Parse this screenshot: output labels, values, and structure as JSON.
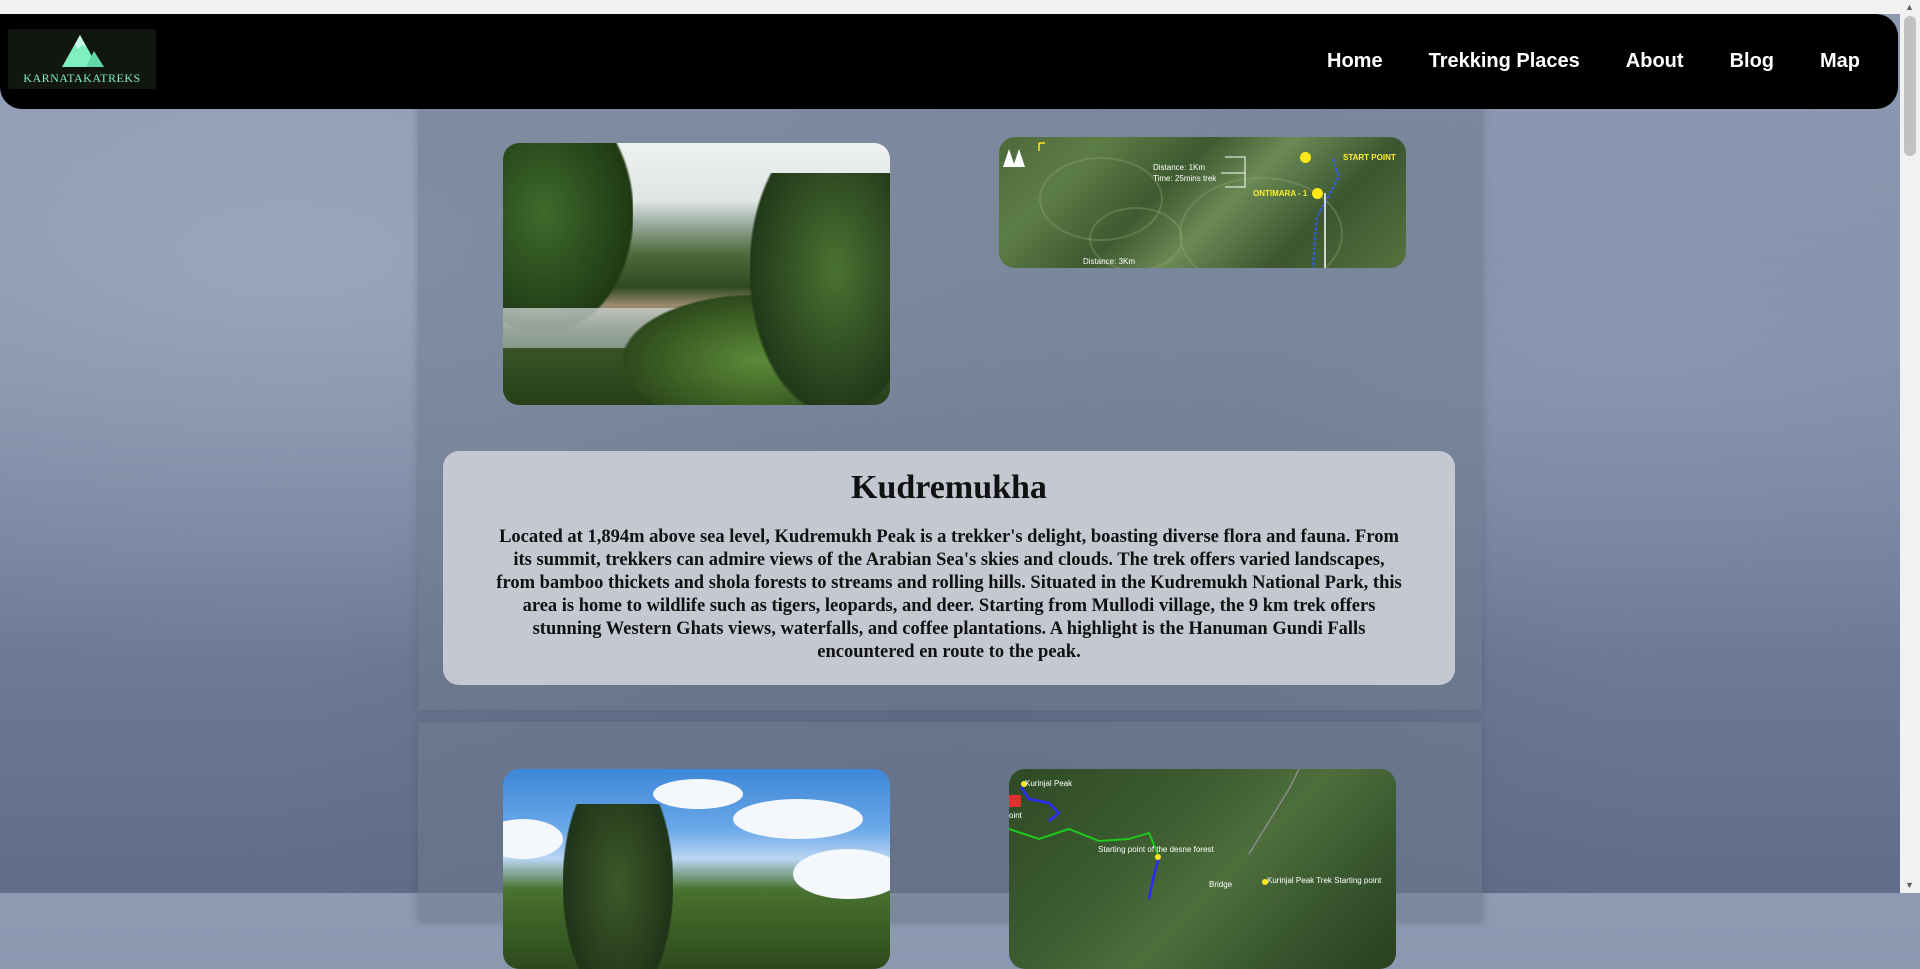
{
  "nav": {
    "logo_text": "KARNATAKATREKS",
    "links": [
      "Home",
      "Trekking Places",
      "About",
      "Blog",
      "Map"
    ]
  },
  "trek1": {
    "map_labels": {
      "start_point": "START POINT",
      "ontimara": "ONTIMARA - 1",
      "distance_1km": "Distance: 1Km",
      "time": "Time: 25mins trek",
      "distance_3km": "Distance: 3Km"
    },
    "title": "Kudremukha",
    "description": "Located at 1,894m above sea level, Kudremukh Peak is a trekker's delight, boasting diverse flora and fauna. From its summit, trekkers can admire views of the Arabian Sea's skies and clouds. The trek offers varied landscapes, from bamboo thickets and shola forests to streams and rolling hills. Situated in the Kudremukh National Park, this area is home to wildlife such as tigers, leopards, and deer. Starting from Mullodi village, the 9 km trek offers stunning Western Ghats views, waterfalls, and coffee plantations. A highlight is the Hanuman Gundi Falls encountered en route to the peak."
  },
  "trek2": {
    "map_labels": {
      "peak": "Kurinjal Peak",
      "point": "oint",
      "dense_forest": "Starting point of the desne forest",
      "bridge": "Bridge",
      "trek_start": "Kurinjal Peak Trek Starting point"
    }
  },
  "colors": {
    "navbar": "#000000",
    "logo_accent": "#7ff0c0",
    "card": "#c4c9d1",
    "map_marker": "#ffe81a"
  }
}
